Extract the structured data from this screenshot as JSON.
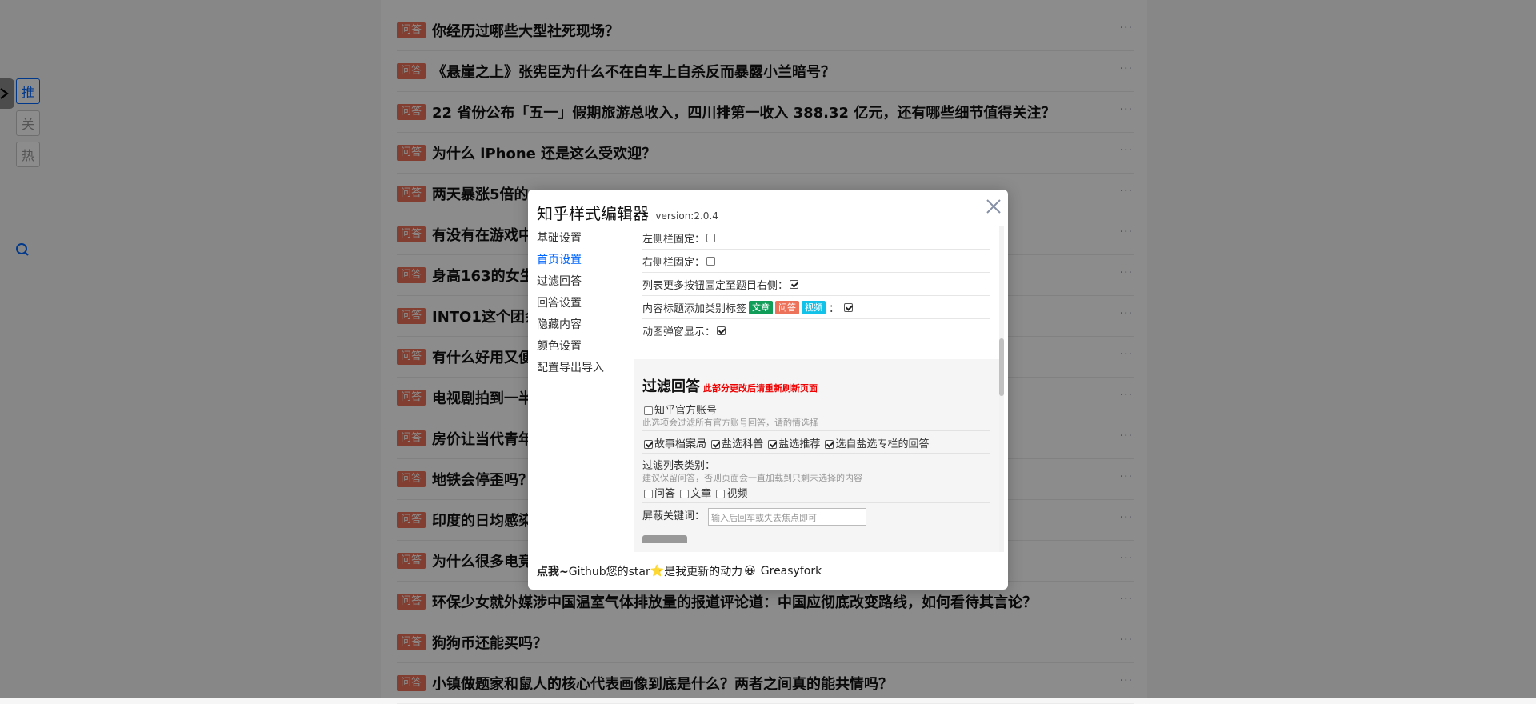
{
  "side_nav": {
    "buttons": [
      "推",
      "关",
      "热"
    ]
  },
  "list": {
    "tag_label": "问答",
    "more_label": "···",
    "items": [
      "你经历过哪些大型社死现场？",
      "《悬崖之上》张宪臣为什么不在白车上自杀反而暴露小兰暗号？",
      "22 省份公布「五一」假期旅游总收入，四川排第一收入 388.32 亿元，还有哪些细节值得关注？",
      "为什么 iPhone 还是这么受欢迎？",
      "两天暴涨5倍的s",
      "有没有在游戏中",
      "身高163的女生",
      "INTO1这个团会",
      "有什么好用又便",
      "电视剧拍到一半",
      "房价让当代青年",
      "地铁会停歪吗？",
      "印度的日均感染",
      "为什么很多电竞",
      "环保少女就外媒涉中国温室气体排放量的报道评论道：中国应彻底改变路线，如何看待其言论？",
      "狗狗币还能买吗？",
      "小镇做题家和鼠人的核心代表画像到底是什么？两者之间真的能共情吗？"
    ]
  },
  "modal": {
    "title": "知乎样式编辑器",
    "version": "version:2.0.4",
    "menu": [
      "基础设置",
      "首页设置",
      "过滤回答",
      "回答设置",
      "隐藏内容",
      "颜色设置",
      "配置导出导入"
    ],
    "active_menu": 1,
    "settings": [
      {
        "label": "左侧栏固定：",
        "checked": false
      },
      {
        "label": "右侧栏固定：",
        "checked": false
      },
      {
        "label": "列表更多按钮固定至题目右侧：",
        "checked": true
      },
      {
        "label": "内容标题添加类别标签",
        "checked": true,
        "pills": [
          "文章",
          "问答",
          "视频"
        ],
        "suffix": "："
      },
      {
        "label": "动图弹窗显示：",
        "checked": true
      }
    ],
    "pill_colors": [
      "#0f9d58",
      "#ec7259",
      "#12c2e9"
    ],
    "filter": {
      "heading": "过滤回答",
      "note": "此部分更改后请重新刷新页面",
      "official_label": "知乎官方账号",
      "official_hint": "此选项会过滤所有官方账号回答，请酌情选择",
      "official_checked": false,
      "options": [
        {
          "label": "故事档案局",
          "checked": true
        },
        {
          "label": "盐选科普",
          "checked": true
        },
        {
          "label": "盐选推荐",
          "checked": true
        },
        {
          "label": "选自盐选专栏的回答",
          "checked": true
        }
      ],
      "types_label": "过滤列表类别：",
      "types_hint": "建议保留问答，否则页面会一直加载到只剩未选择的内容",
      "types": [
        {
          "label": "问答",
          "checked": false
        },
        {
          "label": "文章",
          "checked": false
        },
        {
          "label": "视频",
          "checked": false
        }
      ],
      "keyword_label": "屏蔽关键词：",
      "keyword_placeholder": "输入后回车或失去焦点即可"
    },
    "footer": {
      "click_me": "点我~",
      "github_text": "Github您的star",
      "star": "⭐",
      "update_text": "是我更新的动力",
      "emoji": "😀",
      "greasyfork": "Greasyfork"
    }
  }
}
